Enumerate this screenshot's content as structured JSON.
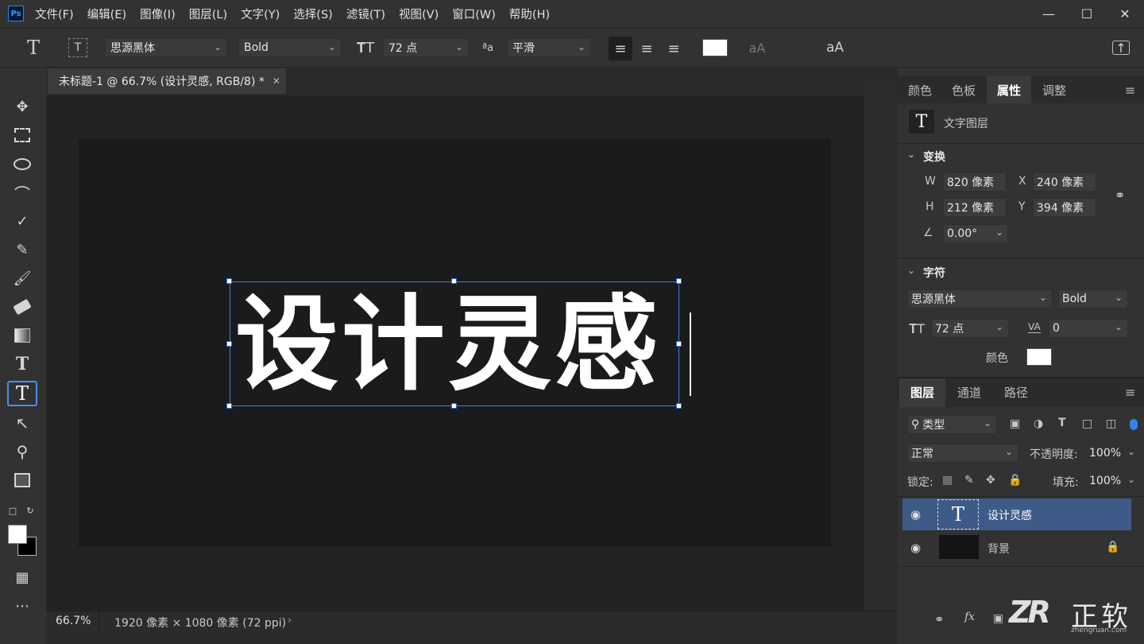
{
  "app": {
    "logo": "Ps"
  },
  "menu": [
    "文件(F)",
    "编辑(E)",
    "图像(I)",
    "图层(L)",
    "文字(Y)",
    "选择(S)",
    "滤镜(T)",
    "视图(V)",
    "窗口(W)",
    "帮助(H)"
  ],
  "options": {
    "font_family": "思源黑体",
    "font_style": "Bold",
    "font_size": "72 点",
    "antialias": "平滑",
    "text_color": "#ffffff"
  },
  "document": {
    "tab_title": "未标题-1 @ 66.7% (设计灵感, RGB/8) *",
    "canvas_text": "设计灵感",
    "zoom": "66.7%",
    "info": "1920 像素 × 1080 像素 (72 ppi)"
  },
  "panels": {
    "top_tabs": [
      "颜色",
      "色板",
      "属性",
      "调整"
    ],
    "active_top_tab": "属性",
    "layer_type_label": "文字图层",
    "transform": {
      "header": "变换",
      "w_label": "W",
      "w": "820 像素",
      "x_label": "X",
      "x": "240 像素",
      "h_label": "H",
      "h": "212 像素",
      "y_label": "Y",
      "y": "394 像素",
      "angle": "0.00°"
    },
    "character": {
      "header": "字符",
      "font": "思源黑体",
      "style": "Bold",
      "size": "72 点",
      "tracking": "0",
      "color_label": "颜色",
      "color": "#ffffff"
    },
    "layer_tabs": [
      "图层",
      "通道",
      "路径"
    ],
    "filter_kind": "类型",
    "blend_mode": "正常",
    "opacity_label": "不透明度:",
    "opacity": "100%",
    "lock_label": "锁定:",
    "fill_label": "填充:",
    "fill": "100%",
    "layers": [
      {
        "name": "设计灵感",
        "type": "text",
        "selected": true
      },
      {
        "name": "背景",
        "type": "background",
        "locked": true
      }
    ]
  },
  "watermark": {
    "logo": "ZR",
    "text": "正软",
    "url": "zhengruan.com"
  }
}
